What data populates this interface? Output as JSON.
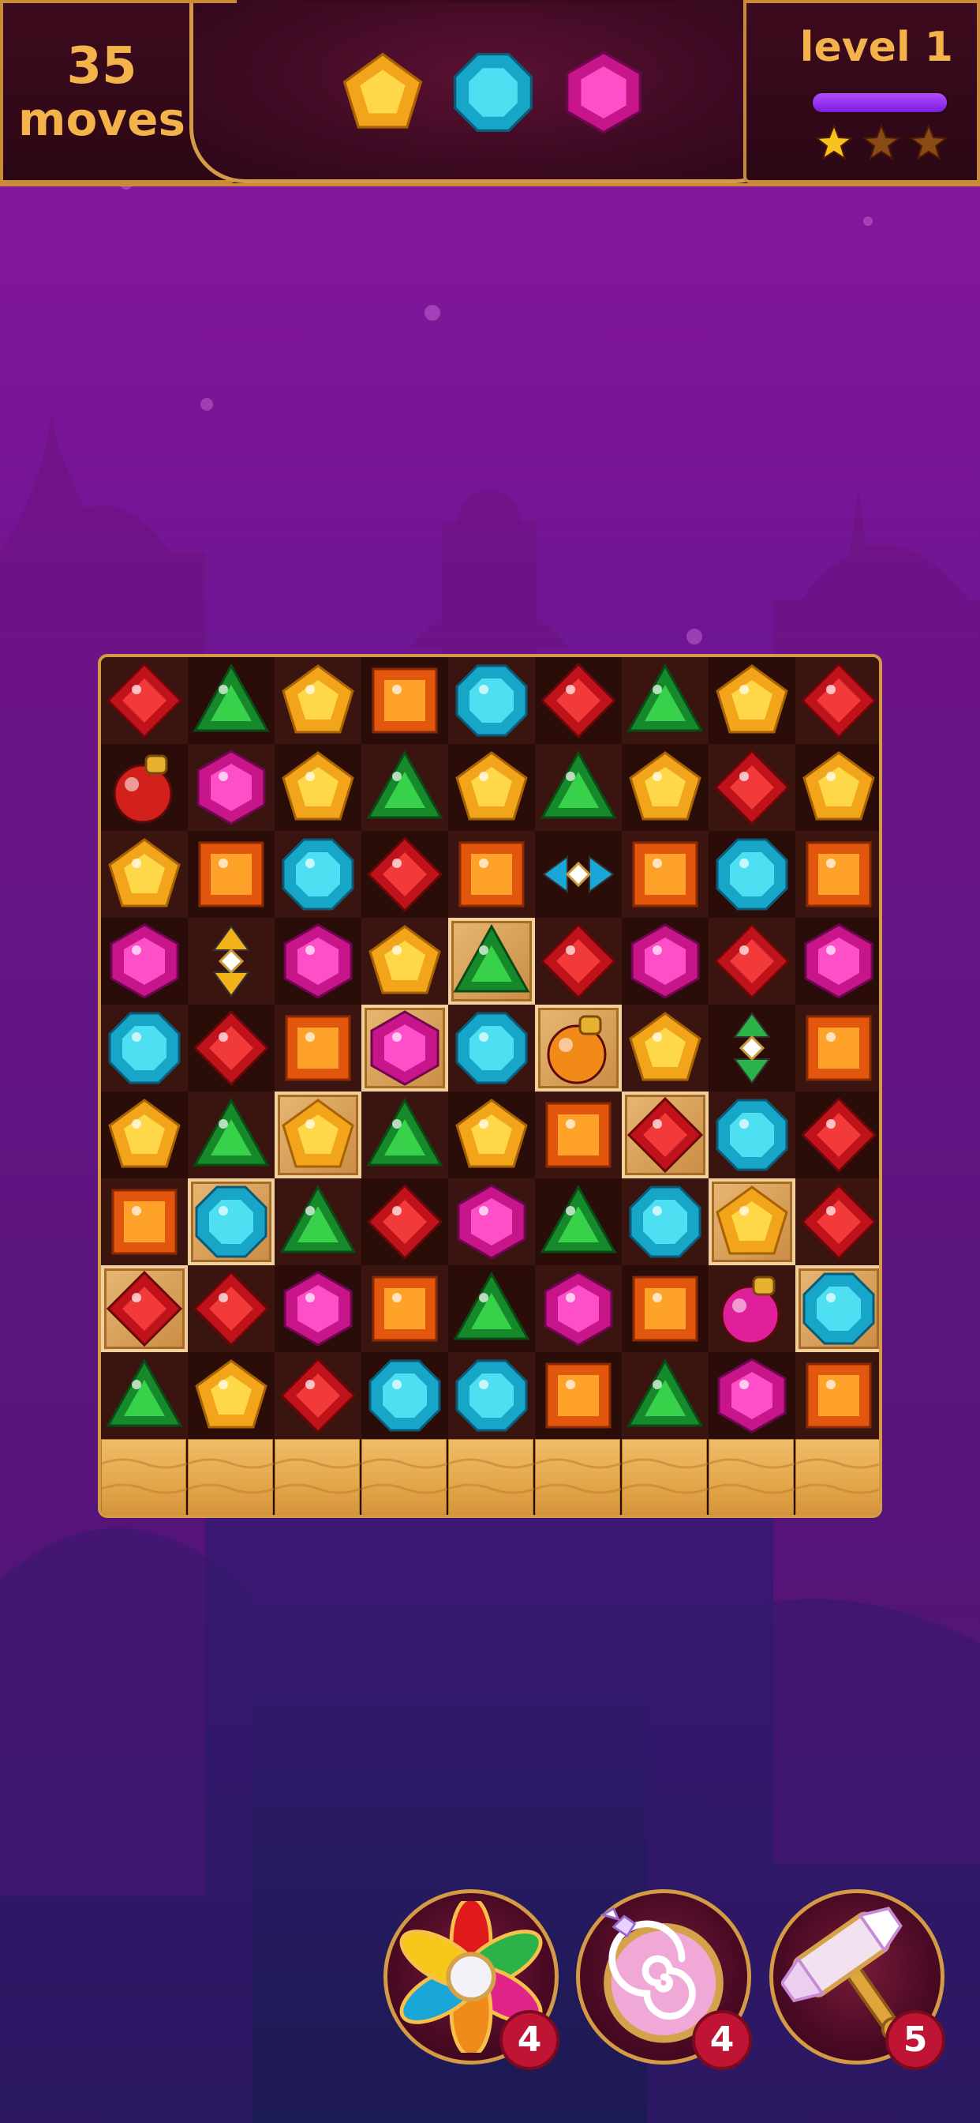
{
  "hud": {
    "moves_count": "35",
    "moves_label": "moves",
    "level_label": "level 1",
    "progress_fraction": 1.0,
    "stars_earned": 1,
    "stars_total": 3,
    "goals": [
      "yellow-pentagon-gem",
      "cyan-octagon-gem",
      "magenta-hexagon-gem"
    ]
  },
  "board": {
    "columns": 9,
    "rows": 9,
    "grid": [
      [
        "red",
        "green",
        "yellow",
        "orange",
        "cyan",
        "red",
        "green",
        "yellow",
        "red"
      ],
      [
        "bomb-red",
        "magenta",
        "yellow",
        "green",
        "yellow",
        "green",
        "yellow",
        "red",
        "yellow"
      ],
      [
        "yellow",
        "orange",
        "cyan",
        "red",
        "orange",
        "rocket-cyan-h",
        "orange",
        "cyan",
        "orange"
      ],
      [
        "magenta",
        "rocket-yellow-v",
        "magenta",
        "yellow",
        "green",
        "red",
        "magenta",
        "red",
        "magenta"
      ],
      [
        "cyan",
        "red",
        "orange",
        "magenta",
        "cyan",
        "bomb-orange",
        "yellow",
        "rocket-green-v",
        "orange"
      ],
      [
        "yellow",
        "green",
        "yellow",
        "green",
        "yellow",
        "orange",
        "red",
        "cyan",
        "red"
      ],
      [
        "orange",
        "cyan",
        "green",
        "red",
        "magenta",
        "green",
        "cyan",
        "yellow",
        "red"
      ],
      [
        "red",
        "red",
        "magenta",
        "orange",
        "green",
        "magenta",
        "orange",
        "bomb-magenta",
        "cyan"
      ],
      [
        "green",
        "yellow",
        "red",
        "cyan",
        "cyan",
        "orange",
        "green",
        "magenta",
        "orange"
      ]
    ],
    "tiled_cells": [
      [
        3,
        4
      ],
      [
        4,
        3
      ],
      [
        4,
        5
      ],
      [
        5,
        2
      ],
      [
        5,
        6
      ],
      [
        6,
        1
      ],
      [
        6,
        7
      ],
      [
        7,
        0
      ],
      [
        7,
        8
      ]
    ],
    "sand_row_cells": 9
  },
  "boosters": [
    {
      "name": "flower-jewel-booster",
      "count": "4"
    },
    {
      "name": "swirl-orb-booster",
      "count": "4"
    },
    {
      "name": "crystal-hammer-booster",
      "count": "5"
    }
  ],
  "colors": {
    "gold": "#f3b24a",
    "frame": "#d49a46",
    "panel": "#2b0714",
    "badge": "#c01434"
  }
}
